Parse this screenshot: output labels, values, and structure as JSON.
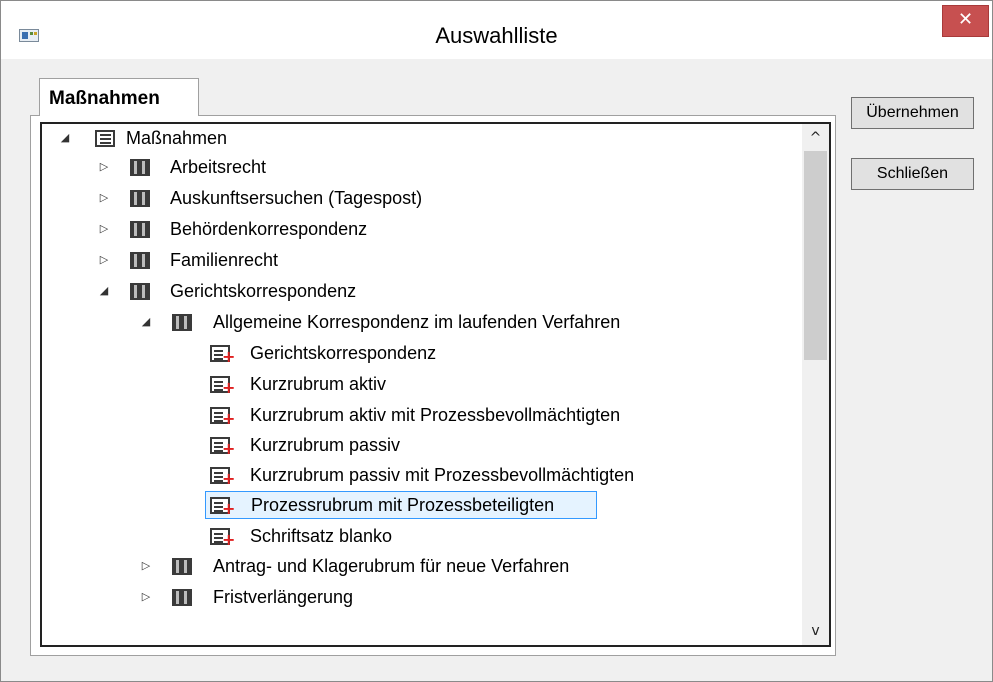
{
  "window": {
    "title": "Auswahlliste",
    "close_glyph": "✕"
  },
  "tab": {
    "label": "Maßnahmen"
  },
  "tree": {
    "root": {
      "label": "Maßnahmen",
      "icon": "list-icon",
      "expanded": true
    },
    "items": [
      {
        "label": "Arbeitsrecht",
        "icon": "folder-icon",
        "expanded": false
      },
      {
        "label": "Auskunftsersuchen (Tagespost)",
        "icon": "folder-icon",
        "expanded": false
      },
      {
        "label": "Behördenkorrespondenz",
        "icon": "folder-icon",
        "expanded": false
      },
      {
        "label": "Familienrecht",
        "icon": "folder-icon",
        "expanded": false
      },
      {
        "label": "Gerichtskorrespondenz",
        "icon": "folder-icon",
        "expanded": true
      },
      {
        "label": "Allgemeine Korrespondenz im laufenden Verfahren",
        "icon": "folder-icon",
        "expanded": true
      },
      {
        "label": "Gerichtskorrespondenz",
        "icon": "document-add-icon"
      },
      {
        "label": "Kurzrubrum aktiv",
        "icon": "document-add-icon"
      },
      {
        "label": "Kurzrubrum aktiv mit Prozessbevollmächtigten",
        "icon": "document-add-icon"
      },
      {
        "label": "Kurzrubrum passiv",
        "icon": "document-add-icon"
      },
      {
        "label": "Kurzrubrum passiv mit Prozessbevollmächtigten",
        "icon": "document-add-icon"
      },
      {
        "label": "Prozessrubrum mit Prozessbeteiligten",
        "icon": "document-add-icon",
        "selected": true
      },
      {
        "label": "Schriftsatz blanko",
        "icon": "document-add-icon"
      },
      {
        "label": "Antrag- und Klagerubrum für neue Verfahren",
        "icon": "folder-icon",
        "expanded": false
      },
      {
        "label": "Fristverlängerung",
        "icon": "folder-icon",
        "expanded": false
      }
    ]
  },
  "scrollbar": {
    "up_glyph": "^",
    "down_glyph": "v"
  },
  "buttons": {
    "apply_label": "Übernehmen",
    "close_label": "Schließen"
  },
  "colors": {
    "close_button": "#c75050",
    "selection_border": "#3399ff",
    "selection_fill": "#e5f3ff",
    "plus_red": "#e02020"
  }
}
